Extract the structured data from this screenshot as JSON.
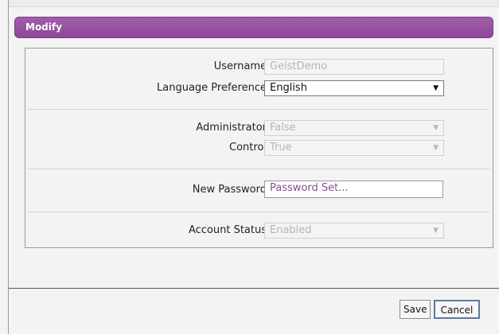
{
  "dialog": {
    "title": "Modify"
  },
  "form": {
    "username": {
      "label": "Username",
      "value": "GeistDemo"
    },
    "language": {
      "label": "Language Preference",
      "value": "English"
    },
    "administrator": {
      "label": "Administrator",
      "value": "False"
    },
    "control": {
      "label": "Control",
      "value": "True"
    },
    "new_password": {
      "label": "New Password",
      "value": "Password Set..."
    },
    "account_status": {
      "label": "Account Status",
      "value": "Enabled"
    }
  },
  "buttons": {
    "save": "Save",
    "cancel": "Cancel"
  },
  "icons": {
    "dropdown": "chevron-down-icon"
  },
  "colors": {
    "accent": "#94509e",
    "password_text": "#8a4a95"
  }
}
